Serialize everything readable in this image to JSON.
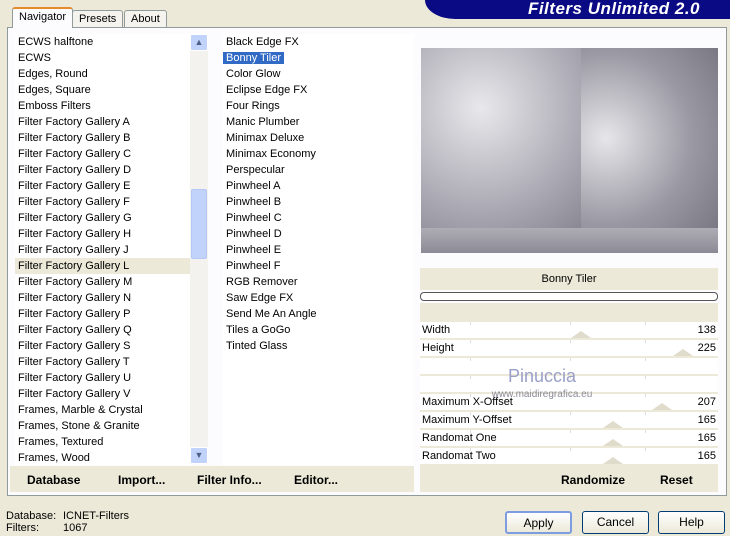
{
  "title": "Filters Unlimited 2.0",
  "tabs": [
    {
      "label": "Navigator"
    },
    {
      "label": "Presets"
    },
    {
      "label": "About"
    }
  ],
  "categories": {
    "selected": "Filter Factory Gallery L",
    "items": [
      "ECWS halftone",
      "ECWS",
      "Edges, Round",
      "Edges, Square",
      "Emboss Filters",
      "Filter Factory Gallery A",
      "Filter Factory Gallery B",
      "Filter Factory Gallery C",
      "Filter Factory Gallery D",
      "Filter Factory Gallery E",
      "Filter Factory Gallery F",
      "Filter Factory Gallery G",
      "Filter Factory Gallery H",
      "Filter Factory Gallery J",
      "Filter Factory Gallery L",
      "Filter Factory Gallery M",
      "Filter Factory Gallery N",
      "Filter Factory Gallery P",
      "Filter Factory Gallery Q",
      "Filter Factory Gallery S",
      "Filter Factory Gallery T",
      "Filter Factory Gallery U",
      "Filter Factory Gallery V",
      "Frames, Marble & Crystal",
      "Frames, Stone & Granite",
      "Frames, Textured",
      "Frames, Wood"
    ]
  },
  "filters": {
    "selected": "Bonny Tiler",
    "items": [
      "Black Edge FX",
      "Bonny Tiler",
      "Color Glow",
      "Eclipse Edge FX",
      "Four Rings",
      "Manic Plumber",
      "Minimax Deluxe",
      "Minimax Economy",
      "Perspecular",
      "Pinwheel A",
      "Pinwheel B",
      "Pinwheel C",
      "Pinwheel D",
      "Pinwheel E",
      "Pinwheel F",
      "RGB Remover",
      "Saw Edge FX",
      "Send Me An Angle",
      "Tiles a GoGo",
      "Tinted Glass"
    ]
  },
  "filter_name": "Bonny Tiler",
  "params": [
    {
      "label": "Width",
      "value": 138
    },
    {
      "label": "Height",
      "value": 225
    },
    null,
    null,
    {
      "label": "Maximum X-Offset",
      "value": 207
    },
    {
      "label": "Maximum Y-Offset",
      "value": 165
    },
    {
      "label": "Randomat One",
      "value": 165
    },
    {
      "label": "Randomat Two",
      "value": 165
    }
  ],
  "param_max": 255,
  "watermark": {
    "name": "Pinuccia",
    "site": "www.maidiregrafica.eu"
  },
  "left_buttons": {
    "database": "Database",
    "import": "Import...",
    "filter_info": "Filter Info...",
    "editor": "Editor..."
  },
  "right_buttons": {
    "randomize": "Randomize",
    "reset": "Reset"
  },
  "status": {
    "database_label": "Database:",
    "database_value": "ICNET-Filters",
    "filters_label": "Filters:",
    "filters_value": "1067"
  },
  "dialog_buttons": {
    "apply": "Apply",
    "cancel": "Cancel",
    "help": "Help"
  },
  "colors": {
    "banner": "#0a0a84",
    "selection": "#316ac5"
  }
}
